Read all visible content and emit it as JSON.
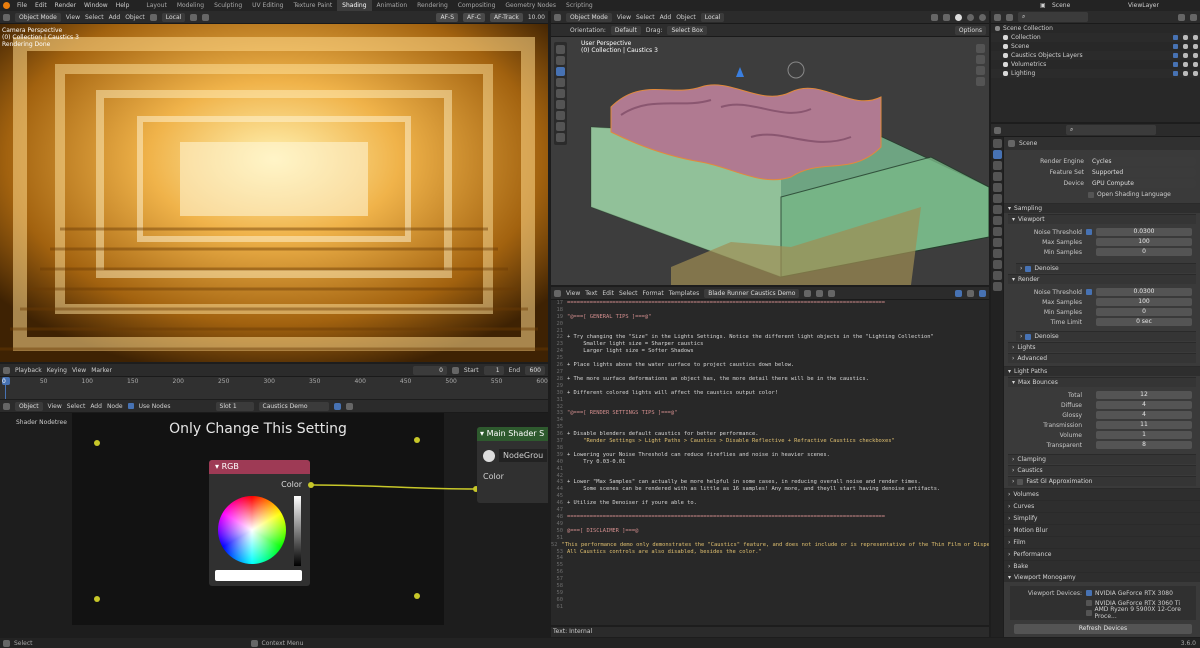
{
  "topbar": {
    "menus": [
      "File",
      "Edit",
      "Render",
      "Window",
      "Help"
    ],
    "workspaces": [
      "Layout",
      "Modeling",
      "Sculpting",
      "UV Editing",
      "Texture Paint",
      "Shading",
      "Animation",
      "Rendering",
      "Compositing",
      "Geometry Nodes",
      "Scripting"
    ],
    "active_workspace": "Shading",
    "scene": "Scene",
    "view_layer": "ViewLayer"
  },
  "left_viewport": {
    "mode": "Object Mode",
    "menus": [
      "View",
      "Select",
      "Add",
      "Object"
    ],
    "transform": "Local",
    "extra": [
      "AF-S",
      "AF-C",
      "AF-Track",
      "10.00"
    ],
    "overlay_lines": [
      "Camera Perspective",
      "(0) Collection | Caustics 3",
      "Rendering Done"
    ]
  },
  "timeline": {
    "menus": [
      "Playback",
      "Keying",
      "View",
      "Marker"
    ],
    "current_frame": "0",
    "start_label": "Start",
    "start": "1",
    "end_label": "End",
    "end": "600",
    "ticks": [
      "0",
      "50",
      "100",
      "150",
      "200",
      "250",
      "300",
      "350",
      "400",
      "450",
      "500",
      "550",
      "600"
    ]
  },
  "node_editor": {
    "object_label": "Object",
    "menus": [
      "View",
      "Select",
      "Add",
      "Node"
    ],
    "use_nodes": "Use Nodes",
    "slot": "Slot 1",
    "material": "Caustics Demo",
    "tree_label": "Shader Nodetree",
    "frame_title": "Only Change This Setting",
    "rgb_node_title": "RGB",
    "rgb_output": "Color",
    "main_node_title": "Main Shader S",
    "main_node_input": "Color",
    "nodegroup": "NodeGrou"
  },
  "right_viewport": {
    "mode": "Object Mode",
    "menus": [
      "View",
      "Select",
      "Add",
      "Object"
    ],
    "transform": "Local",
    "orientation_label": "Orientation:",
    "orientation": "Default",
    "drag_label": "Drag:",
    "drag": "Select Box",
    "options": "Options",
    "overlay_lines": [
      "User Perspective",
      "(0) Collection | Caustics 3"
    ]
  },
  "text_editor": {
    "menus": [
      "View",
      "Text",
      "Edit",
      "Select",
      "Format",
      "Templates"
    ],
    "filename": "Blade Runner Caustics Demo",
    "footer": "Text: Internal",
    "lines": [
      {
        "n": "16",
        "t": ""
      },
      {
        "n": "17",
        "t": "=================================================================================================="
      },
      {
        "n": "18",
        "t": ""
      },
      {
        "n": "19",
        "t": "\"@===[ GENERAL TIPS ]===@\""
      },
      {
        "n": "20",
        "t": ""
      },
      {
        "n": "21",
        "t": ""
      },
      {
        "n": "22",
        "t": "+ Try changing the \"Size\" in the Lights Settings. Notice the different light objects in the \"Lighting Collection\""
      },
      {
        "n": "23",
        "t": "     Smaller light size = Sharper caustics"
      },
      {
        "n": "24",
        "t": "     Larger light size = Softer Shadows"
      },
      {
        "n": "25",
        "t": ""
      },
      {
        "n": "26",
        "t": "+ Place lights above the water surface to project caustics down below."
      },
      {
        "n": "27",
        "t": ""
      },
      {
        "n": "28",
        "t": "+ The more surface deformations an object has, the more detail there will be in the caustics."
      },
      {
        "n": "29",
        "t": ""
      },
      {
        "n": "30",
        "t": "+ Different colored lights will affect the caustics output color!"
      },
      {
        "n": "31",
        "t": ""
      },
      {
        "n": "32",
        "t": ""
      },
      {
        "n": "33",
        "t": "\"@===[ RENDER SETTINGS TIPS ]===@\""
      },
      {
        "n": "34",
        "t": ""
      },
      {
        "n": "35",
        "t": ""
      },
      {
        "n": "36",
        "t": "+ Disable blenders default caustics for better performance."
      },
      {
        "n": "37",
        "t": "     \"Render Settings > Light Paths > Caustics > Disable Reflective + Refractive Caustics checkboxes\""
      },
      {
        "n": "38",
        "t": ""
      },
      {
        "n": "39",
        "t": "+ Lowering your Noise Threshold can reduce fireflies and noise in heavier scenes."
      },
      {
        "n": "40",
        "t": "     Try 0.03-0.01"
      },
      {
        "n": "41",
        "t": ""
      },
      {
        "n": "42",
        "t": ""
      },
      {
        "n": "43",
        "t": "+ Lower \"Max Samples\" can actually be more helpful in some cases, in reducing overall noise and render times."
      },
      {
        "n": "44",
        "t": "     Some scenes can be rendered with as little as 16 samples! Any more, and theyll start having denoise artifacts."
      },
      {
        "n": "45",
        "t": ""
      },
      {
        "n": "46",
        "t": "+ Utilize the Denoiser if youre able to."
      },
      {
        "n": "47",
        "t": ""
      },
      {
        "n": "48",
        "t": "=================================================================================================="
      },
      {
        "n": "49",
        "t": ""
      },
      {
        "n": "50",
        "t": "@===[ DISCLAIMER ]===@"
      },
      {
        "n": "51",
        "t": ""
      },
      {
        "n": "52",
        "t": "\"This performance demo only demonstrates the \"Caustics\" feature, and does not include or is representative of the Thin Film or Dispers"
      },
      {
        "n": "53",
        "t": "All Caustics controls are also disabled, besides the color.\""
      },
      {
        "n": "54",
        "t": ""
      },
      {
        "n": "55",
        "t": ""
      },
      {
        "n": "56",
        "t": ""
      },
      {
        "n": "57",
        "t": ""
      },
      {
        "n": "58",
        "t": ""
      },
      {
        "n": "59",
        "t": ""
      },
      {
        "n": "60",
        "t": ""
      },
      {
        "n": "61",
        "t": ""
      }
    ]
  },
  "outliner": {
    "items": [
      {
        "name": "Scene Collection",
        "indent": 0
      },
      {
        "name": "Collection",
        "indent": 1
      },
      {
        "name": "Scene",
        "indent": 1
      },
      {
        "name": "Caustics Objects Layers",
        "indent": 1
      },
      {
        "name": "Volumetrics",
        "indent": 1
      },
      {
        "name": "Lighting",
        "indent": 1
      }
    ]
  },
  "properties": {
    "scene_label": "Scene",
    "render_engine_label": "Render Engine",
    "render_engine": "Cycles",
    "feature_set_label": "Feature Set",
    "feature_set": "Supported",
    "device_label": "Device",
    "device": "GPU Compute",
    "osl": "Open Shading Language",
    "sampling": "Sampling",
    "viewport": "Viewport",
    "noise_threshold_label": "Noise Threshold",
    "vp_noise": "0.0300",
    "max_samples_label": "Max Samples",
    "vp_max": "100",
    "min_samples_label": "Min Samples",
    "vp_min": "0",
    "denoise": "Denoise",
    "render": "Render",
    "r_noise": "0.0300",
    "r_max": "100",
    "r_min": "0",
    "time_limit_label": "Time Limit",
    "time_limit": "0 sec",
    "denoise2": "Denoise",
    "lights": "Lights",
    "advanced": "Advanced",
    "light_paths": "Light Paths",
    "max_bounces": "Max Bounces",
    "bounces": [
      {
        "label": "Total",
        "value": "12"
      },
      {
        "label": "Diffuse",
        "value": "4"
      },
      {
        "label": "Glossy",
        "value": "4"
      },
      {
        "label": "Transmission",
        "value": "11"
      },
      {
        "label": "Volume",
        "value": "1"
      },
      {
        "label": "Transparent",
        "value": "8"
      }
    ],
    "clamping": "Clamping",
    "caustics": "Caustics",
    "fast_gi": "Fast GI Approximation",
    "sections": [
      "Volumes",
      "Curves",
      "Simplify",
      "Motion Blur",
      "Film",
      "Performance",
      "Bake"
    ],
    "viewport_monogamy": "Viewport Monogamy",
    "viewport_devices_label": "Viewport Devices:",
    "devices": [
      {
        "name": "NVIDIA GeForce RTX 3080",
        "on": true
      },
      {
        "name": "NVIDIA GeForce RTX 3060 Ti",
        "on": false
      },
      {
        "name": "AMD Ryzen 9 5900X 12-Core Proce...",
        "on": false
      }
    ],
    "refresh": "Refresh Devices"
  },
  "statusbar": {
    "select": "Select",
    "context_menu": "Context Menu",
    "version": "3.6.0"
  },
  "colors": {
    "accent": "#4772b3",
    "rgb_header": "#9e3a55",
    "main_node_header": "#2e5a2e",
    "socket": "#c7c729"
  }
}
